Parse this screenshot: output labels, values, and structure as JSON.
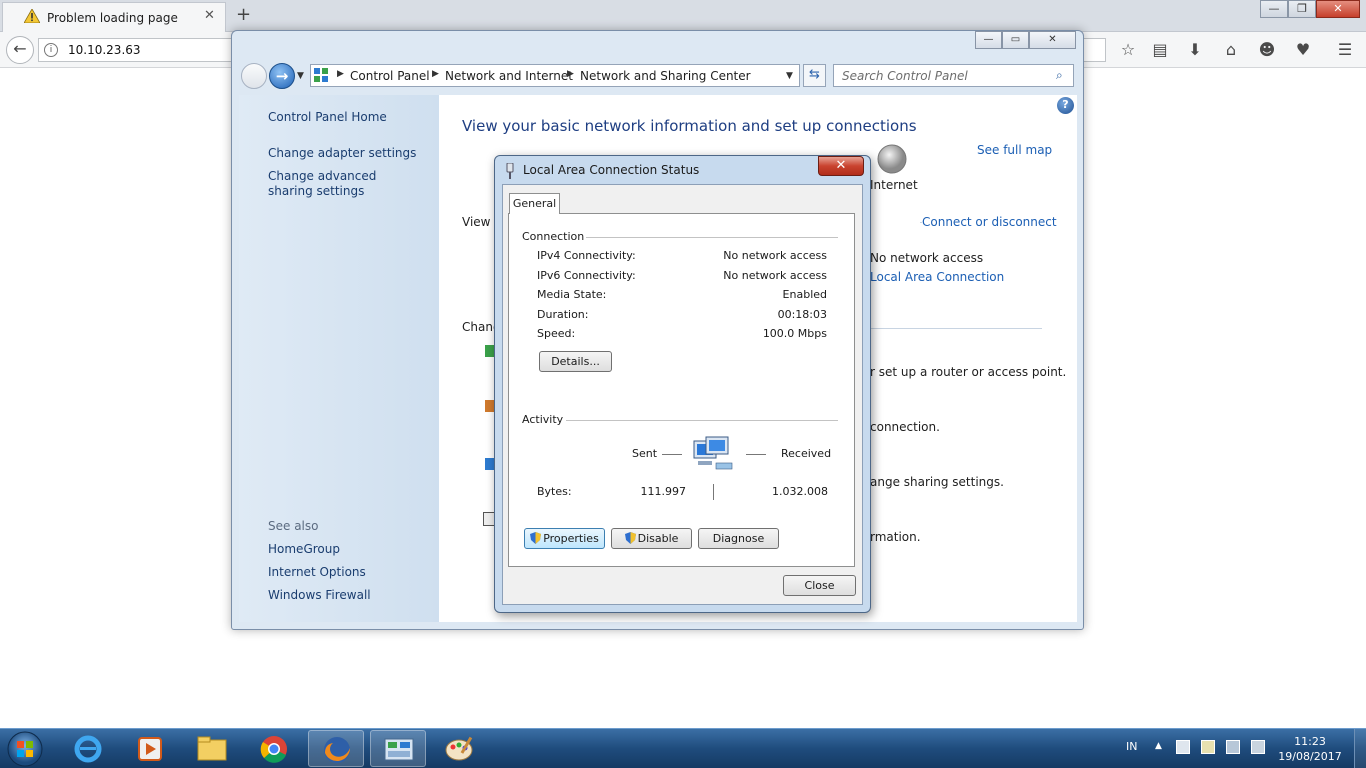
{
  "browser": {
    "tab_title": "Problem loading page",
    "url": "10.10.23.63",
    "tab_close": "✕",
    "new_tab": "+",
    "toolbar_icons": [
      "star-icon",
      "reading-list-icon",
      "download-icon",
      "home-icon",
      "pocket-face-icon",
      "pocket-icon",
      "menu-icon"
    ]
  },
  "window": {
    "breadcrumb": [
      "Control Panel",
      "Network and Internet",
      "Network and Sharing Center"
    ],
    "search_placeholder": "Search Control Panel",
    "sidebar": {
      "items": [
        "Control Panel Home",
        "Change adapter settings",
        "Change advanced sharing settings"
      ],
      "see_also_heading": "See also",
      "see_also": [
        "HomeGroup",
        "Internet Options",
        "Windows Firewall"
      ]
    },
    "main": {
      "title": "View your basic network information and set up connections",
      "see_full_map": "See full map",
      "internet_label": "Internet",
      "connect_disconnect": "Connect or disconnect",
      "view_active_partial": "View y",
      "access_type": "No network access",
      "connection_link": "Local Area Connection",
      "change_heading_partial": "Chang",
      "tasks": [
        "r set up a router or access point.",
        "connection.",
        "ange sharing settings.",
        "rmation."
      ]
    }
  },
  "dialog": {
    "title": "Local Area Connection Status",
    "close": "✕",
    "tab": "General",
    "connection_heading": "Connection",
    "connection_rows": [
      {
        "label": "IPv4 Connectivity:",
        "value": "No network access"
      },
      {
        "label": "IPv6 Connectivity:",
        "value": "No network access"
      },
      {
        "label": "Media State:",
        "value": "Enabled"
      },
      {
        "label": "Duration:",
        "value": "00:18:03"
      },
      {
        "label": "Speed:",
        "value": "100.0 Mbps"
      }
    ],
    "details_button": "Details...",
    "activity_heading": "Activity",
    "sent_label": "Sent",
    "received_label": "Received",
    "bytes_label": "Bytes:",
    "bytes_sent": "111.997",
    "bytes_received": "1.032.008",
    "properties_button": "Properties",
    "disable_button": "Disable",
    "diagnose_button": "Diagnose",
    "close_button": "Close"
  },
  "taskbar": {
    "apps": [
      "internet-explorer",
      "media-player",
      "file-explorer",
      "chrome",
      "firefox",
      "control-panel",
      "paint"
    ],
    "lang": "IN",
    "time": "11:23",
    "date": "19/08/2017"
  }
}
